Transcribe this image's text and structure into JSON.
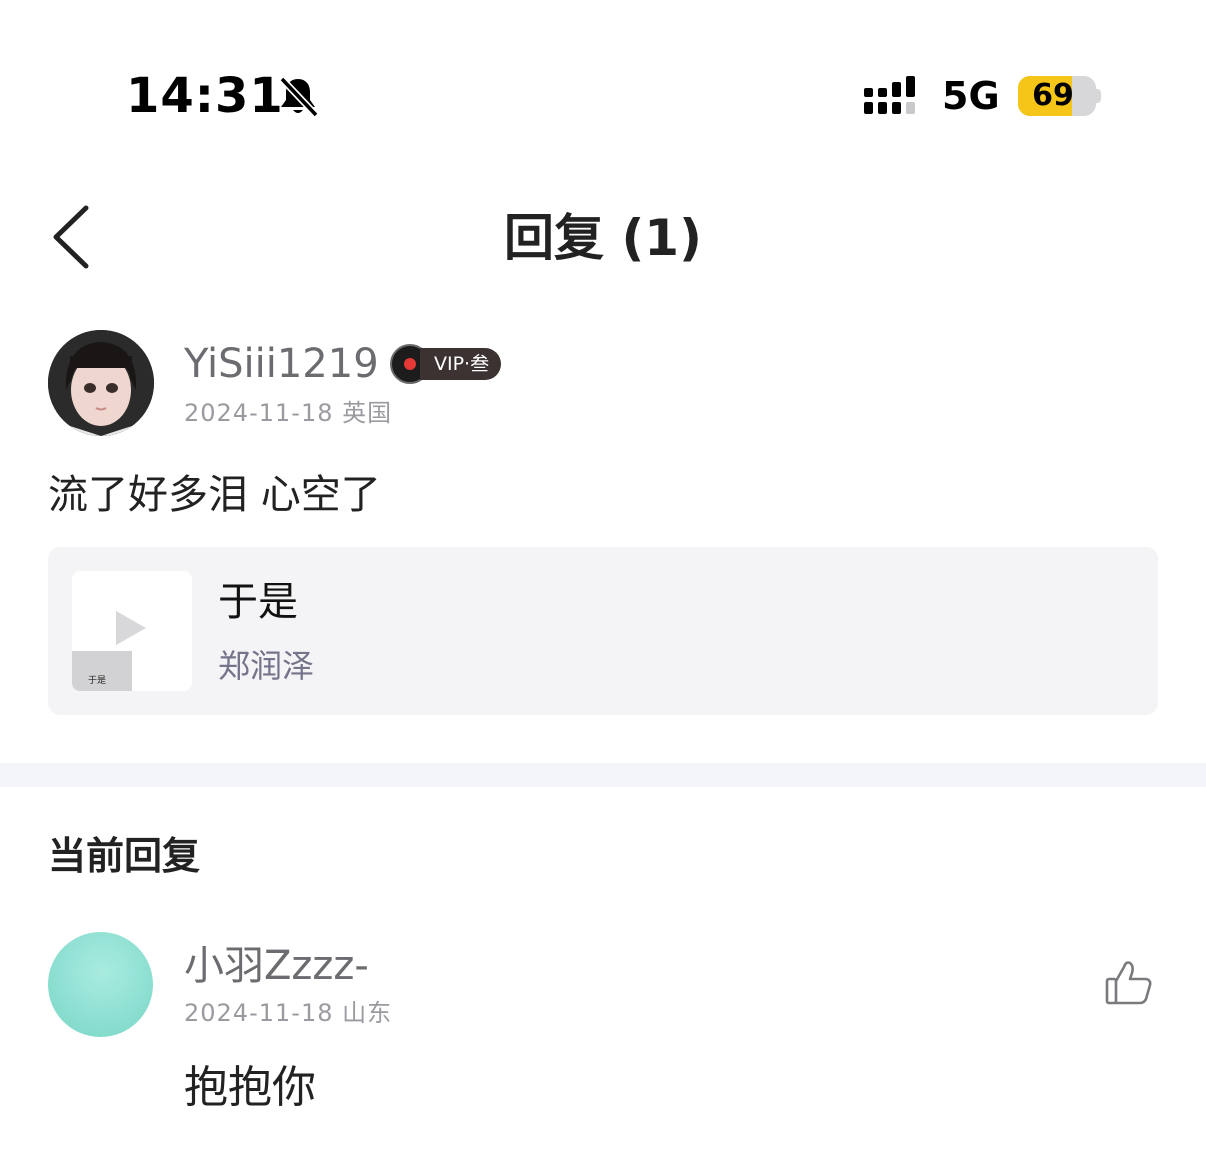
{
  "status_bar": {
    "time": "14:31",
    "network": "5G",
    "battery_level": 69,
    "battery_text": "69",
    "battery_color": "#f5c518",
    "icons": [
      "bell-slash-icon",
      "signal-icon",
      "battery-icon"
    ]
  },
  "nav": {
    "title": "回复 (1)",
    "back_icon": "chevron-left-icon"
  },
  "comment": {
    "username": "YiSiii1219",
    "vip_label": "VIP·叁",
    "date": "2024-11-18",
    "location": "英国",
    "text": "流了好多泪 心空了",
    "song": {
      "title": "于是",
      "artist": "郑润泽",
      "cover_text": "于是",
      "cover_icon": "play-icon"
    }
  },
  "current_reply": {
    "section_title": "当前回复",
    "username": "小羽Zzzz-",
    "date": "2024-11-18",
    "location": "山东",
    "text": "抱抱你",
    "like_icon": "thumbs-up-icon"
  }
}
